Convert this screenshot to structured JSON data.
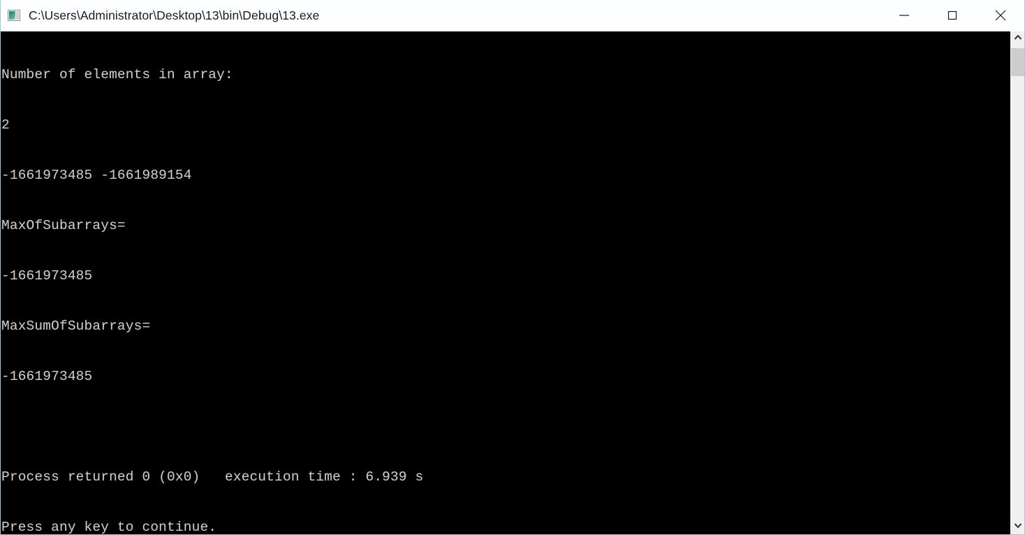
{
  "window": {
    "title": "C:\\Users\\Administrator\\Desktop\\13\\bin\\Debug\\13.exe",
    "icon": "console-app-icon",
    "border_color": "#9fc6e0",
    "titlebar_bg": "#fdfeff",
    "controls": {
      "minimize_label": "Minimize",
      "maximize_label": "Maximize",
      "close_label": "Close"
    }
  },
  "console": {
    "background_color": "#000000",
    "text_color": "#cccccc",
    "lines": [
      "Number of elements in array:",
      "2",
      "-1661973485 -1661989154",
      "MaxOfSubarrays=",
      "-1661973485",
      "MaxSumOfSubarrays=",
      "-1661973485",
      "",
      "Process returned 0 (0x0)   execution time : 6.939 s",
      "Press any key to continue."
    ]
  },
  "scrollbar": {
    "up_arrow": "chevron-up-icon",
    "down_arrow": "chevron-down-icon",
    "track_color": "#f0f0f0",
    "thumb_color": "#cdcdcd"
  }
}
